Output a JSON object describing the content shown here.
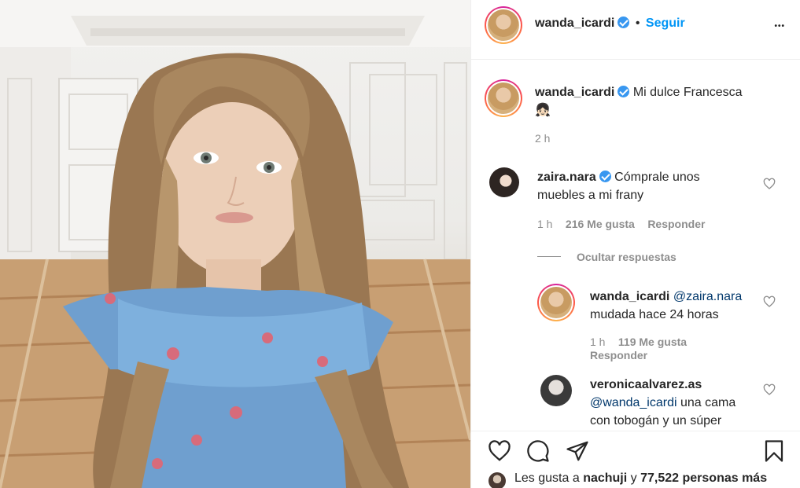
{
  "post": {
    "author": "wanda_icardi",
    "follow_label": "Seguir",
    "dot_separator": "•",
    "more_label": "•••",
    "caption_text": "Mi dulce Francesca",
    "caption_emoji": "👧🏻",
    "caption_time": "2 h"
  },
  "comments": [
    {
      "author": "zaira.nara",
      "text_line1": "Cómprale unos",
      "text_line2": "muebles a mi frany",
      "time": "1 h",
      "likes": "216 Me gusta",
      "reply_label": "Responder"
    }
  ],
  "replies_toggle": "Ocultar respuestas",
  "replies": [
    {
      "author": "wanda_icardi",
      "mention": "@zaira.nara",
      "text": "mudada hace 24 horas",
      "time": "1 h",
      "likes": "119 Me gusta",
      "reply_label": "Responder"
    },
    {
      "author": "veronicaalvarez.as",
      "mention": "@wanda_icardi",
      "text_line1": "una cama",
      "text_line2": "con tobogán y un súper"
    }
  ],
  "likes_summary": {
    "prefix": "Les gusta a",
    "user": "nachuji",
    "connector": "y",
    "count": "77,522 personas más"
  },
  "icons": {
    "verified": "verified-badge-icon",
    "heart": "heart-icon",
    "comment": "comment-icon",
    "share": "share-icon",
    "save": "bookmark-icon",
    "more": "more-options-icon"
  },
  "colors": {
    "link_blue": "#0095f6",
    "verified_blue": "#3897f0",
    "text": "#262626",
    "muted": "#8e8e8e"
  }
}
